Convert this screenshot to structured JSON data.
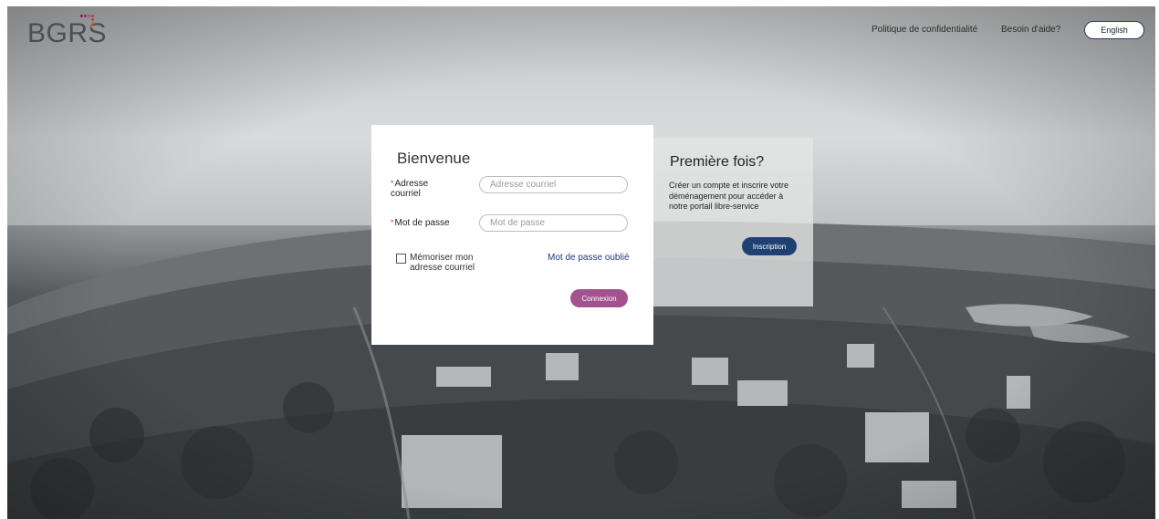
{
  "header": {
    "logo_text": "BGRS",
    "nav": {
      "privacy": "Politique de confidentialité",
      "help": "Besoin d'aide?",
      "language": "English"
    }
  },
  "login": {
    "title": "Bienvenue",
    "email": {
      "label": "Adresse courriel",
      "placeholder": "Adresse courriel",
      "value": ""
    },
    "password": {
      "label": "Mot de passe",
      "placeholder": "Mot de passe",
      "value": ""
    },
    "remember_label": "Mémoriser mon adresse courriel",
    "forgot_link": "Mot de passe oublié",
    "submit_label": "Connexion",
    "required_marker": "*"
  },
  "signup": {
    "title": "Première fois?",
    "description": "Créer un compte et inscrire votre déménagement pour accéder à notre portail libre-service",
    "button_label": "Inscription"
  },
  "colors": {
    "accent_submit": "#a1528f",
    "accent_signup": "#1f4172",
    "link": "#1f3c7a",
    "required": "#d13a3a"
  }
}
